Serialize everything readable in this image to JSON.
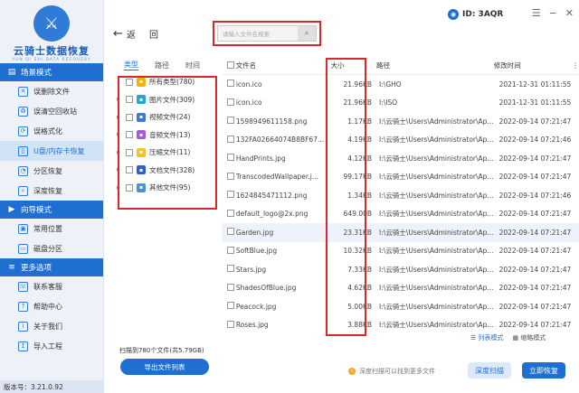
{
  "app": {
    "name": "云骑士数据恢复",
    "sub": "YUN QI SHI DATA RECOVERY",
    "version_label": "版本号：3.21.0.92"
  },
  "sidebar": {
    "sections": [
      {
        "label": "场景模式",
        "items": [
          {
            "label": "误删除文件"
          },
          {
            "label": "误清空回收站"
          },
          {
            "label": "误格式化"
          },
          {
            "label": "U盘/内存卡恢复"
          },
          {
            "label": "分区恢复"
          },
          {
            "label": "深度恢复"
          }
        ]
      },
      {
        "label": "向导模式",
        "items": [
          {
            "label": "常用位置"
          },
          {
            "label": "磁盘分区"
          }
        ]
      },
      {
        "label": "更多选项",
        "items": [
          {
            "label": "联系客服"
          },
          {
            "label": "帮助中心"
          },
          {
            "label": "关于我们"
          },
          {
            "label": "导入工程"
          }
        ]
      }
    ]
  },
  "header": {
    "back_label": "返",
    "back2_label": "回",
    "search_placeholder": "请输入文件名搜索",
    "user_id": "ID: 3AQR"
  },
  "tabs": [
    "类型",
    "路径",
    "时间"
  ],
  "tree": [
    {
      "label": "所有类型(780)",
      "color": "#f5b400"
    },
    {
      "label": "图片文件(309)",
      "color": "#27a3d9"
    },
    {
      "label": "视频文件(24)",
      "color": "#3a7bd5"
    },
    {
      "label": "音频文件(13)",
      "color": "#a45ad6"
    },
    {
      "label": "压缩文件(11)",
      "color": "#f2c230"
    },
    {
      "label": "文档文件(328)",
      "color": "#2f62c8"
    },
    {
      "label": "其他文件(95)",
      "color": "#4a90e2"
    }
  ],
  "table": {
    "headers": [
      "文件名",
      "大小",
      "路径",
      "修改时间"
    ],
    "rows": [
      [
        "icon.ico",
        "21.96KB",
        "I:\\GHO",
        "2021-12-31 01:11:55"
      ],
      [
        "icon.ico",
        "21.96KB",
        "I:\\ISO",
        "2021-12-31 01:11:55"
      ],
      [
        "1598949611158.png",
        "1.17KB",
        "I:\\云骑士\\Users\\Administrator\\Ap...",
        "2022-09-14 07:21:47"
      ],
      [
        "132FA02664074B8BF67...",
        "4.19KB",
        "I:\\云骑士\\Users\\Administrator\\Ap...",
        "2022-09-14 07:21:46"
      ],
      [
        "HandPrints.jpg",
        "4.12KB",
        "I:\\云骑士\\Users\\Administrator\\Ap...",
        "2022-09-14 07:21:47"
      ],
      [
        "TranscodedWallpaper.j...",
        "99.17KB",
        "I:\\云骑士\\Users\\Administrator\\Ap...",
        "2022-09-14 07:21:47"
      ],
      [
        "1624845471112.png",
        "1.34KB",
        "I:\\云骑士\\Users\\Administrator\\Ap...",
        "2022-09-14 07:21:46"
      ],
      [
        "default_logo@2x.png",
        "649.00B",
        "I:\\云骑士\\Users\\Administrator\\Ap...",
        "2022-09-14 07:21:47"
      ],
      [
        "Garden.jpg",
        "23.31KB",
        "I:\\云骑士\\Users\\Administrator\\Ap...",
        "2022-09-14 07:21:47"
      ],
      [
        "SoftBlue.jpg",
        "10.32KB",
        "I:\\云骑士\\Users\\Administrator\\Ap...",
        "2022-09-14 07:21:47"
      ],
      [
        "Stars.jpg",
        "7.33KB",
        "I:\\云骑士\\Users\\Administrator\\Ap...",
        "2022-09-14 07:21:47"
      ],
      [
        "ShadesOfBlue.jpg",
        "4.62KB",
        "I:\\云骑士\\Users\\Administrator\\Ap...",
        "2022-09-14 07:21:47"
      ],
      [
        "Peacock.jpg",
        "5.00KB",
        "I:\\云骑士\\Users\\Administrator\\Ap...",
        "2022-09-14 07:21:47"
      ],
      [
        "Roses.jpg",
        "3.88KB",
        "I:\\云骑士\\Users\\Administrator\\Ap...",
        "2022-09-14 07:21:47"
      ]
    ]
  },
  "footer": {
    "stats": "扫描到780个文件(共5.79GB)",
    "export_label": "导出文件列表",
    "view_list": "列表模式",
    "view_grid": "缩略模式",
    "deep_hint": "深度扫描可以找到更多文件",
    "deep_btn": "深度扫描",
    "recover_btn": "立即恢复"
  },
  "colors": {
    "accent": "#1f6fd0",
    "highlight": "#d6282d"
  }
}
